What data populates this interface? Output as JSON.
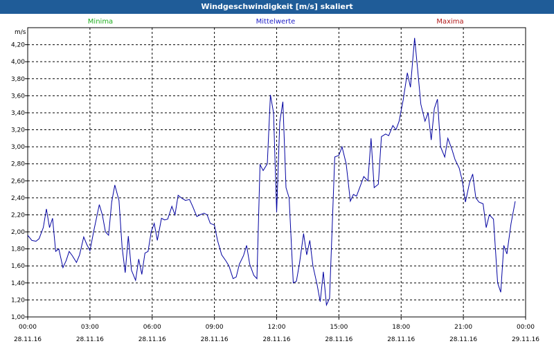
{
  "chart_data": {
    "type": "line",
    "title": "Windgeschwindigkeit [m/s] skaliert",
    "ylabel": "m/s",
    "legend": {
      "minima": "Minima",
      "mittelwerte": "Mittelwerte",
      "maxima": "Maxima"
    },
    "ylim": [
      1.0,
      4.4
    ],
    "yticks": [
      "1,00",
      "1,20",
      "1,40",
      "1,60",
      "1,80",
      "2,00",
      "2,20",
      "2,40",
      "2,60",
      "2,80",
      "3,00",
      "3,20",
      "3,40",
      "3,60",
      "3,80",
      "4,00",
      "4,20"
    ],
    "xlim_hours": [
      0,
      24
    ],
    "xticks": [
      {
        "time": "00:00",
        "date": "28.11.16"
      },
      {
        "time": "03:00",
        "date": "28.11.16"
      },
      {
        "time": "06:00",
        "date": "28.11.16"
      },
      {
        "time": "09:00",
        "date": "28.11.16"
      },
      {
        "time": "12:00",
        "date": "28.11.16"
      },
      {
        "time": "15:00",
        "date": "28.11.16"
      },
      {
        "time": "18:00",
        "date": "28.11.16"
      },
      {
        "time": "21:00",
        "date": "28.11.16"
      },
      {
        "time": "00:00",
        "date": "29.11.16"
      }
    ],
    "colors": {
      "minima": "#1fae1f",
      "mittelwerte": "#2020c8",
      "maxima": "#b01818",
      "line": "#0000a0",
      "titlebar": "#1f5c98"
    },
    "grid": true,
    "series": [
      {
        "name": "Mittelwerte",
        "points": [
          [
            0.0,
            1.96
          ],
          [
            0.2,
            1.9
          ],
          [
            0.4,
            1.89
          ],
          [
            0.55,
            1.92
          ],
          [
            0.75,
            2.05
          ],
          [
            0.9,
            2.27
          ],
          [
            1.05,
            2.05
          ],
          [
            1.2,
            2.16
          ],
          [
            1.35,
            1.77
          ],
          [
            1.5,
            1.8
          ],
          [
            1.7,
            1.58
          ],
          [
            1.85,
            1.66
          ],
          [
            2.0,
            1.77
          ],
          [
            2.15,
            1.72
          ],
          [
            2.35,
            1.64
          ],
          [
            2.5,
            1.73
          ],
          [
            2.7,
            1.94
          ],
          [
            2.85,
            1.85
          ],
          [
            3.0,
            1.78
          ],
          [
            3.2,
            2.03
          ],
          [
            3.45,
            2.32
          ],
          [
            3.6,
            2.2
          ],
          [
            3.75,
            2.0
          ],
          [
            3.9,
            1.96
          ],
          [
            4.05,
            2.35
          ],
          [
            4.2,
            2.55
          ],
          [
            4.4,
            2.37
          ],
          [
            4.55,
            1.82
          ],
          [
            4.7,
            1.52
          ],
          [
            4.85,
            1.95
          ],
          [
            5.0,
            1.55
          ],
          [
            5.2,
            1.43
          ],
          [
            5.35,
            1.68
          ],
          [
            5.5,
            1.5
          ],
          [
            5.65,
            1.75
          ],
          [
            5.8,
            1.77
          ],
          [
            5.95,
            2.0
          ],
          [
            6.1,
            2.1
          ],
          [
            6.25,
            1.9
          ],
          [
            6.45,
            2.16
          ],
          [
            6.6,
            2.14
          ],
          [
            6.75,
            2.15
          ],
          [
            6.95,
            2.3
          ],
          [
            7.1,
            2.2
          ],
          [
            7.25,
            2.43
          ],
          [
            7.4,
            2.4
          ],
          [
            7.6,
            2.37
          ],
          [
            7.8,
            2.38
          ],
          [
            7.95,
            2.3
          ],
          [
            8.15,
            2.18
          ],
          [
            8.3,
            2.2
          ],
          [
            8.5,
            2.22
          ],
          [
            8.65,
            2.2
          ],
          [
            8.8,
            2.1
          ],
          [
            9.0,
            2.08
          ],
          [
            9.15,
            1.9
          ],
          [
            9.35,
            1.73
          ],
          [
            9.55,
            1.66
          ],
          [
            9.7,
            1.6
          ],
          [
            9.9,
            1.45
          ],
          [
            10.05,
            1.47
          ],
          [
            10.2,
            1.62
          ],
          [
            10.4,
            1.72
          ],
          [
            10.55,
            1.84
          ],
          [
            10.7,
            1.62
          ],
          [
            10.9,
            1.49
          ],
          [
            11.05,
            1.45
          ],
          [
            11.2,
            2.79
          ],
          [
            11.35,
            2.72
          ],
          [
            11.55,
            2.8
          ],
          [
            11.7,
            3.61
          ],
          [
            11.85,
            3.4
          ],
          [
            12.0,
            2.23
          ],
          [
            12.15,
            3.29
          ],
          [
            12.3,
            3.53
          ],
          [
            12.45,
            2.52
          ],
          [
            12.6,
            2.4
          ],
          [
            12.8,
            1.4
          ],
          [
            12.95,
            1.42
          ],
          [
            13.1,
            1.63
          ],
          [
            13.3,
            1.98
          ],
          [
            13.45,
            1.73
          ],
          [
            13.6,
            1.9
          ],
          [
            13.75,
            1.6
          ],
          [
            13.95,
            1.38
          ],
          [
            14.1,
            1.18
          ],
          [
            14.25,
            1.53
          ],
          [
            14.4,
            1.14
          ],
          [
            14.55,
            1.22
          ],
          [
            14.8,
            2.88
          ],
          [
            15.0,
            2.9
          ],
          [
            15.15,
            3.0
          ],
          [
            15.35,
            2.8
          ],
          [
            15.55,
            2.36
          ],
          [
            15.7,
            2.44
          ],
          [
            15.85,
            2.42
          ],
          [
            16.05,
            2.55
          ],
          [
            16.2,
            2.65
          ],
          [
            16.4,
            2.6
          ],
          [
            16.55,
            3.1
          ],
          [
            16.7,
            2.52
          ],
          [
            16.9,
            2.56
          ],
          [
            17.05,
            3.12
          ],
          [
            17.25,
            3.15
          ],
          [
            17.4,
            3.13
          ],
          [
            17.6,
            3.25
          ],
          [
            17.75,
            3.2
          ],
          [
            17.9,
            3.3
          ],
          [
            18.1,
            3.55
          ],
          [
            18.3,
            3.87
          ],
          [
            18.45,
            3.7
          ],
          [
            18.65,
            4.28
          ],
          [
            18.8,
            3.9
          ],
          [
            18.95,
            3.5
          ],
          [
            19.15,
            3.3
          ],
          [
            19.3,
            3.4
          ],
          [
            19.45,
            3.08
          ],
          [
            19.6,
            3.45
          ],
          [
            19.75,
            3.56
          ],
          [
            19.9,
            3.0
          ],
          [
            20.1,
            2.88
          ],
          [
            20.25,
            3.1
          ],
          [
            20.45,
            2.97
          ],
          [
            20.6,
            2.85
          ],
          [
            20.8,
            2.75
          ],
          [
            20.95,
            2.6
          ],
          [
            21.1,
            2.35
          ],
          [
            21.3,
            2.58
          ],
          [
            21.45,
            2.68
          ],
          [
            21.6,
            2.4
          ],
          [
            21.75,
            2.35
          ],
          [
            21.95,
            2.33
          ],
          [
            22.1,
            2.05
          ],
          [
            22.25,
            2.2
          ],
          [
            22.45,
            2.15
          ],
          [
            22.65,
            1.4
          ],
          [
            22.8,
            1.29
          ],
          [
            22.95,
            1.84
          ],
          [
            23.1,
            1.74
          ],
          [
            23.3,
            2.1
          ],
          [
            23.5,
            2.36
          ]
        ]
      }
    ]
  }
}
